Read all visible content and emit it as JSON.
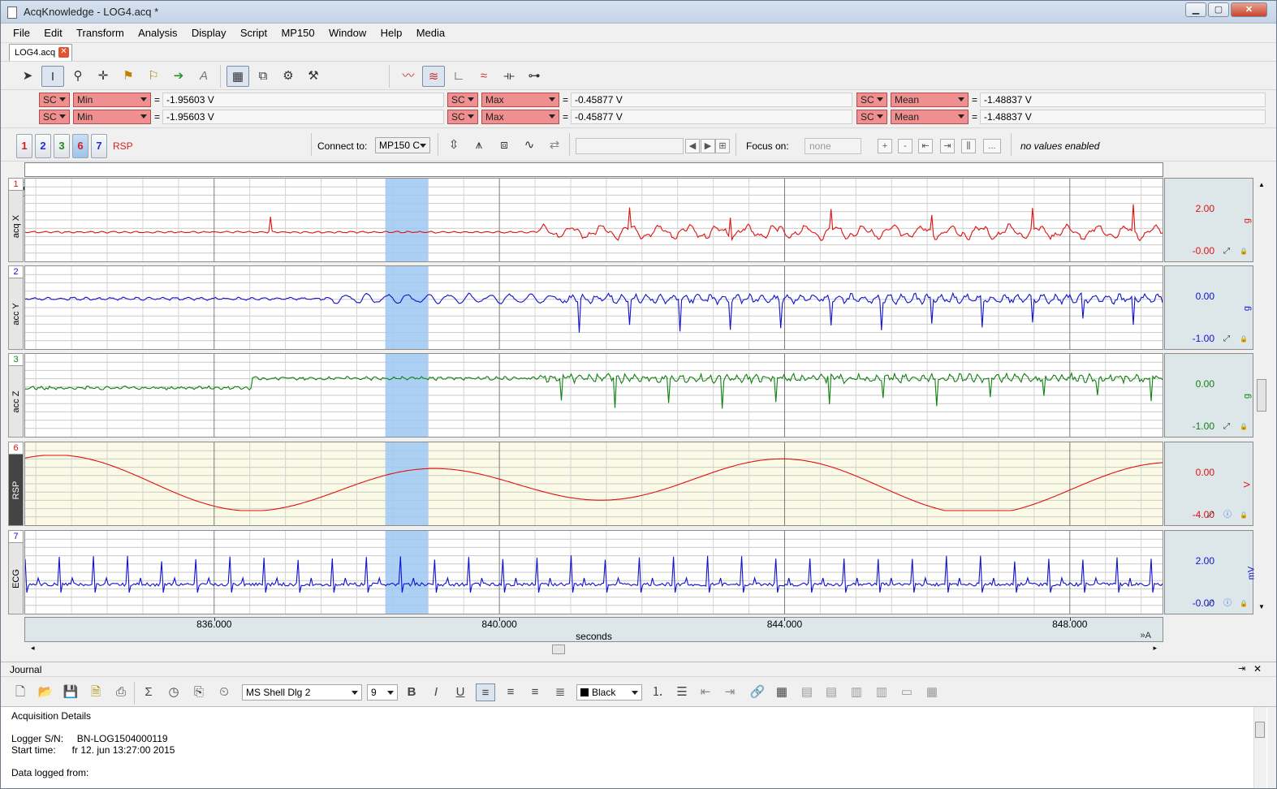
{
  "window": {
    "title": "AcqKnowledge - LOG4.acq *",
    "btn_min": "▁",
    "btn_max": "▢",
    "btn_close": "✕"
  },
  "menu": [
    "File",
    "Edit",
    "Transform",
    "Analysis",
    "Display",
    "Script",
    "MP150",
    "Window",
    "Help",
    "Media"
  ],
  "tab": {
    "label": "LOG4.acq",
    "close": "✕"
  },
  "measurements": {
    "rows": [
      [
        {
          "ch": "SC",
          "fn": "Min",
          "val": "-1.95603 V"
        },
        {
          "ch": "SC",
          "fn": "Max",
          "val": "-0.45877 V"
        },
        {
          "ch": "SC",
          "fn": "Mean",
          "val": "-1.48837 V"
        }
      ],
      [
        {
          "ch": "SC",
          "fn": "Min",
          "val": "-1.95603 V"
        },
        {
          "ch": "SC",
          "fn": "Max",
          "val": "-0.45877 V"
        },
        {
          "ch": "SC",
          "fn": "Mean",
          "val": "-1.48837 V"
        }
      ]
    ],
    "eq": "="
  },
  "channel_buttons": [
    {
      "label": "1",
      "color": "#d61f1f"
    },
    {
      "label": "2",
      "color": "#1f2fd6"
    },
    {
      "label": "3",
      "color": "#1b8a1b"
    },
    {
      "label": "6",
      "color": "#d61f1f"
    },
    {
      "label": "7",
      "color": "#1f2fd6"
    }
  ],
  "rsp_label": "RSP",
  "connect": {
    "label": "Connect to:",
    "value": "MP150 C"
  },
  "focus": {
    "label": "Focus on:",
    "value": "none"
  },
  "focus_buttons": [
    "+",
    "-",
    "⇤",
    "⇥",
    "⫼",
    "..."
  ],
  "status_text": "no values enabled",
  "channels": [
    {
      "num": "1",
      "name": "acq X",
      "color": "#e01010",
      "scale_top": "2.00",
      "scale_bot": "-0.00",
      "unit": "g",
      "dark": false,
      "bg": "#ffffff"
    },
    {
      "num": "2",
      "name": "acc Y",
      "color": "#1010d0",
      "scale_top": "0.00",
      "scale_bot": "-1.00",
      "unit": "g",
      "dark": false,
      "bg": "#ffffff"
    },
    {
      "num": "3",
      "name": "acc Z",
      "color": "#108010",
      "scale_top": "0.00",
      "scale_bot": "-1.00",
      "unit": "g",
      "dark": false,
      "bg": "#ffffff"
    },
    {
      "num": "6",
      "name": "RSP",
      "color": "#e01010",
      "scale_top": "0.00",
      "scale_bot": "-4.00",
      "unit": "V",
      "dark": true,
      "bg": "#fafae6"
    },
    {
      "num": "7",
      "name": "ECG",
      "color": "#1010d0",
      "scale_top": "2.00",
      "scale_bot": "-0.00",
      "unit": "mV",
      "dark": false,
      "bg": "#ffffff"
    }
  ],
  "xaxis": {
    "label": "seconds",
    "ticks": [
      "836.000",
      "840.000",
      "844.000",
      "848.000"
    ],
    "tick_values": [
      836,
      840,
      844,
      848
    ],
    "range": [
      833.35,
      849.3
    ],
    "selection": [
      838.4,
      839.0
    ],
    "autoscale": "A"
  },
  "journal": {
    "title": "Journal",
    "font": "MS Shell Dlg 2",
    "size": "9",
    "color": "Black",
    "lines": [
      "Acquisition Details",
      "",
      "Logger S/N:     BN-LOG1504000119",
      "Start time:      fr 12. jun 13:27:00 2015",
      "",
      "Data logged from:"
    ]
  },
  "colors": {
    "selection": "#9cc8f2",
    "accent_red": "#ef8f8f"
  }
}
